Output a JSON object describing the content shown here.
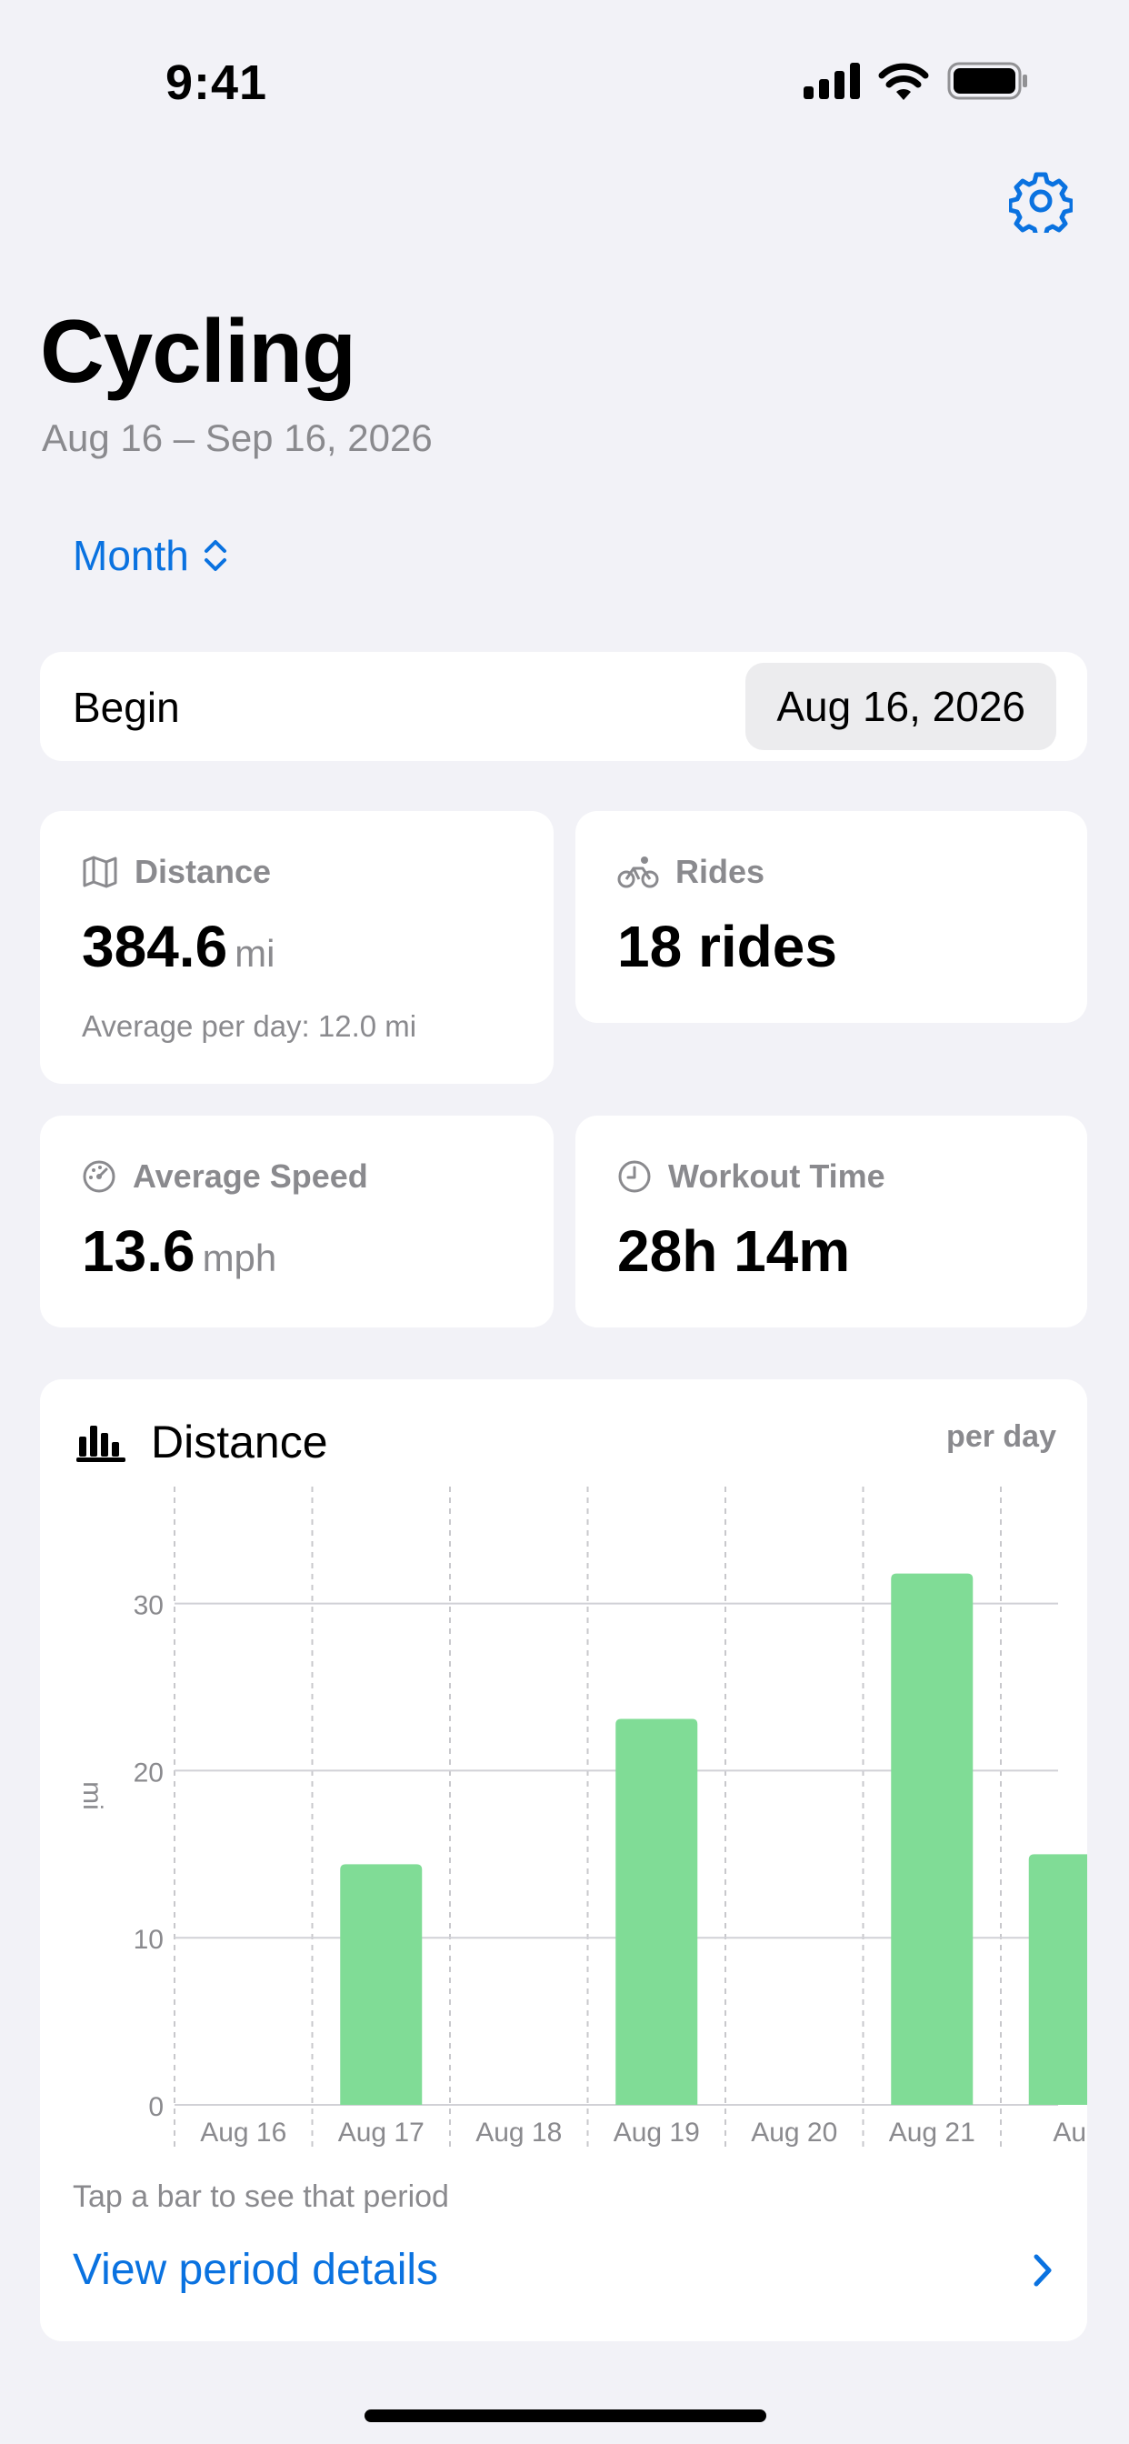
{
  "status_bar": {
    "time": "9:41"
  },
  "header": {
    "title": "Cycling",
    "date_range": "Aug 16 – Sep 16, 2026",
    "period_selector": "Month"
  },
  "begin": {
    "label": "Begin",
    "date": "Aug 16, 2026"
  },
  "stats": {
    "distance": {
      "label": "Distance",
      "value": "384.6",
      "unit": "mi",
      "sub": "Average per day: 12.0 mi"
    },
    "rides": {
      "label": "Rides",
      "value": "18 rides"
    },
    "speed": {
      "label": "Average Speed",
      "value": "13.6",
      "unit": "mph"
    },
    "workout": {
      "label": "Workout Time",
      "value": "28h 14m"
    }
  },
  "chart_section": {
    "title": "Distance",
    "per_day": "per day",
    "hint": "Tap a bar to see that period",
    "details_link": "View period details"
  },
  "chart_data": {
    "type": "bar",
    "categories": [
      "Aug 16",
      "Aug 17",
      "Aug 18",
      "Aug 19",
      "Aug 20",
      "Aug 21",
      "Au"
    ],
    "values": [
      0,
      14.4,
      0,
      23.1,
      0,
      31.8,
      15
    ],
    "ylabel": "mi",
    "yticks": [
      0,
      10,
      20,
      30
    ],
    "ylim": [
      0,
      37
    ],
    "bar_color": "#80dc96",
    "grid": true
  },
  "colors": {
    "accent": "#0a72e0",
    "background": "#f2f2f7"
  }
}
